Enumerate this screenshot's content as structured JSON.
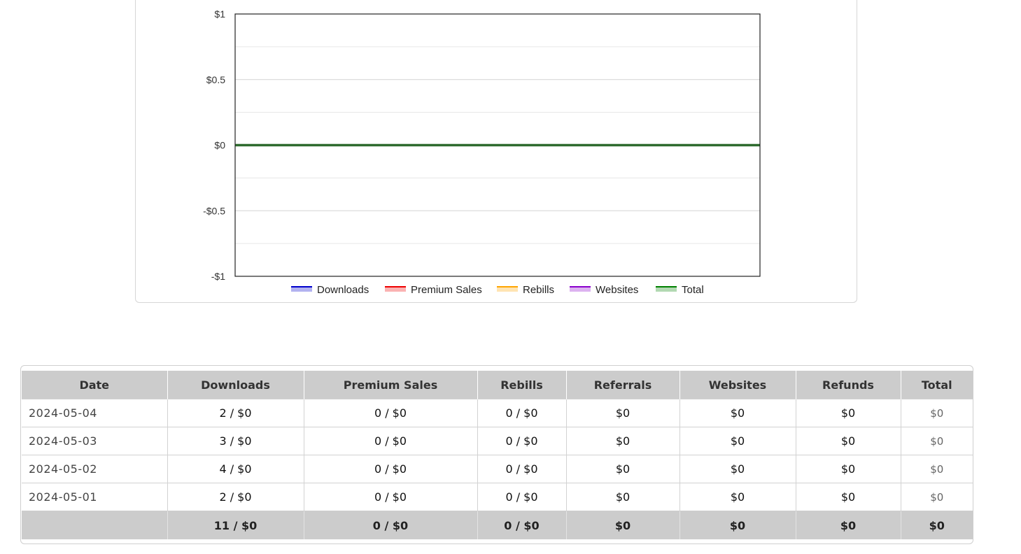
{
  "chart_data": {
    "type": "line",
    "y_ticks": [
      "$1",
      "$0.5",
      "$0",
      "-$0.5",
      "-$1"
    ],
    "ylim": [
      -1,
      1
    ],
    "grid": true,
    "legend_position": "bottom",
    "series": [
      {
        "name": "Downloads",
        "color": "#0000cc",
        "values": [
          0,
          0,
          0,
          0
        ]
      },
      {
        "name": "Premium Sales",
        "color": "#ee0000",
        "values": [
          0,
          0,
          0,
          0
        ]
      },
      {
        "name": "Rebills",
        "color": "#ffa500",
        "values": [
          0,
          0,
          0,
          0
        ]
      },
      {
        "name": "Websites",
        "color": "#8a00cc",
        "values": [
          0,
          0,
          0,
          0
        ]
      },
      {
        "name": "Total",
        "color": "#008000",
        "values": [
          0,
          0,
          0,
          0
        ]
      }
    ]
  },
  "table": {
    "headers": [
      "Date",
      "Downloads",
      "Premium Sales",
      "Rebills",
      "Referrals",
      "Websites",
      "Refunds",
      "Total"
    ],
    "rows": [
      [
        "2024-05-04",
        "2 / $0",
        "0 / $0",
        "0 / $0",
        "$0",
        "$0",
        "$0",
        "$0"
      ],
      [
        "2024-05-03",
        "3 / $0",
        "0 / $0",
        "0 / $0",
        "$0",
        "$0",
        "$0",
        "$0"
      ],
      [
        "2024-05-02",
        "4 / $0",
        "0 / $0",
        "0 / $0",
        "$0",
        "$0",
        "$0",
        "$0"
      ],
      [
        "2024-05-01",
        "2 / $0",
        "0 / $0",
        "0 / $0",
        "$0",
        "$0",
        "$0",
        "$0"
      ]
    ],
    "footer": [
      "",
      "11 / $0",
      "0 / $0",
      "0 / $0",
      "$0",
      "$0",
      "$0",
      "$0"
    ]
  }
}
